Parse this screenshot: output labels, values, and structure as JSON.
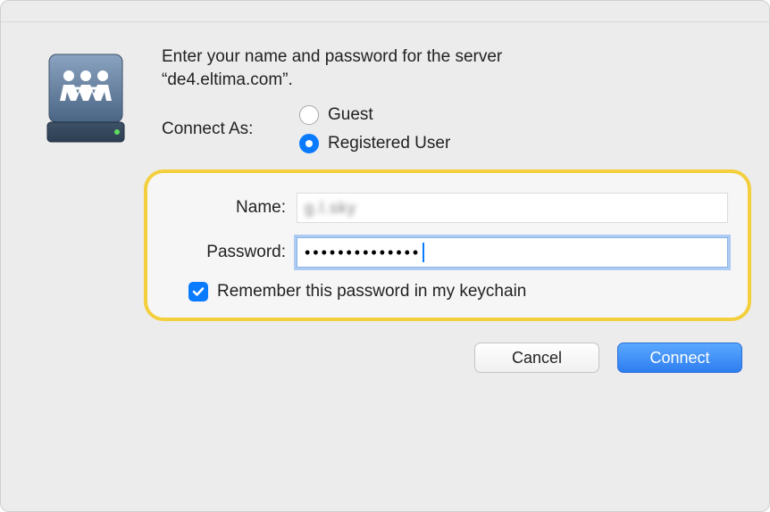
{
  "prompt_line1": "Enter your name and password for the server",
  "prompt_line2": "“de4.eltima.com”.",
  "connect_as_label": "Connect As:",
  "radio": {
    "guest": "Guest",
    "registered": "Registered User",
    "selected": "registered"
  },
  "fields": {
    "name_label": "Name:",
    "name_value_obscured": "g.l.sky",
    "password_label": "Password:",
    "password_mask": "••••••••••••••"
  },
  "remember": {
    "label": "Remember this password in my keychain",
    "checked": true
  },
  "buttons": {
    "cancel": "Cancel",
    "connect": "Connect"
  },
  "icon_name": "network-server-icon"
}
